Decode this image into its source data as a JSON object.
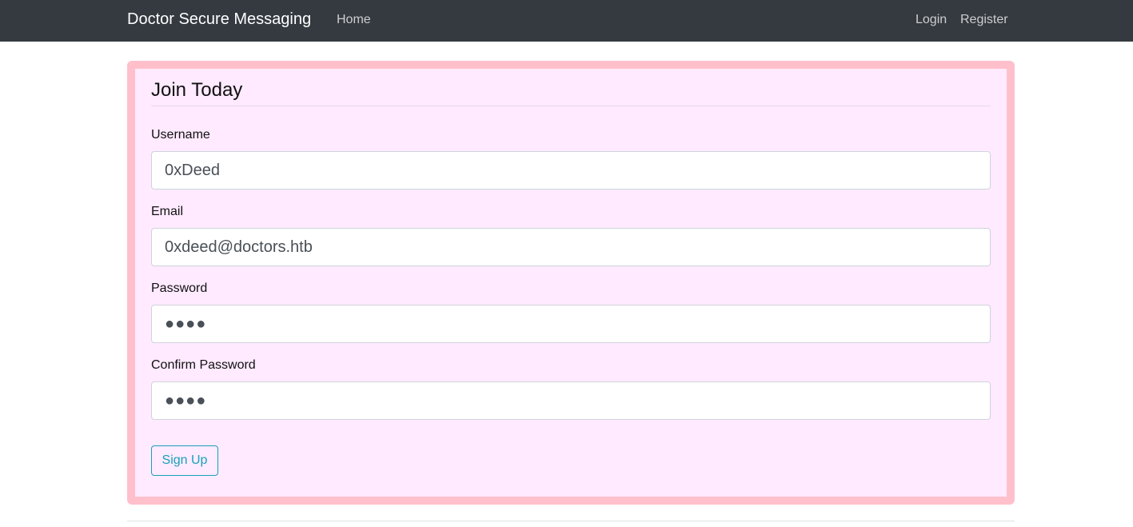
{
  "navbar": {
    "brand": "Doctor Secure Messaging",
    "links": {
      "home": "Home",
      "login": "Login",
      "register": "Register"
    }
  },
  "form": {
    "legend": "Join Today",
    "fields": {
      "username": {
        "label": "Username",
        "value": "0xDeed"
      },
      "email": {
        "label": "Email",
        "value": "0xdeed@doctors.htb"
      },
      "password": {
        "label": "Password",
        "value": "●●●●"
      },
      "confirm_password": {
        "label": "Confirm Password",
        "value": "●●●●"
      }
    },
    "submit_label": "Sign Up"
  },
  "colors": {
    "navbar_bg": "#343a40",
    "card_bg": "#ffeaff",
    "card_border": "#ffc0cb",
    "button_accent": "#17a2b8"
  }
}
